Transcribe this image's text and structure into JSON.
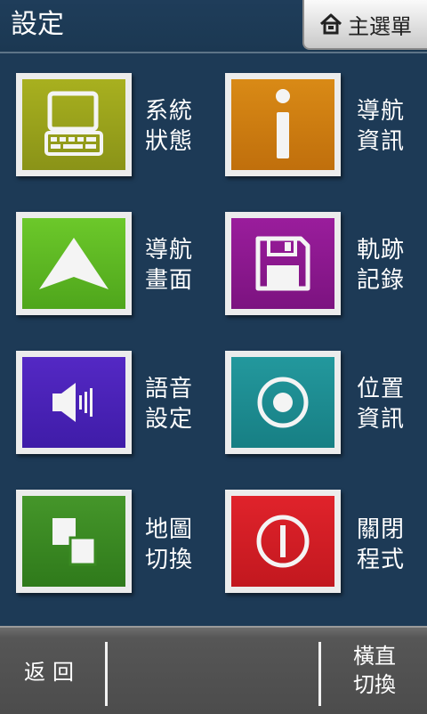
{
  "header": {
    "title": "設定",
    "home_label": "主選單",
    "home_icon": "home-icon"
  },
  "tiles": [
    {
      "label": "系統狀態",
      "icon": "computer-icon",
      "color": "#9aa21d"
    },
    {
      "label": "導航資訊",
      "icon": "info-icon",
      "color": "#d27e10"
    },
    {
      "label": "導航畫面",
      "icon": "arrow-up-icon",
      "color": "#5fbc24"
    },
    {
      "label": "軌跡記錄",
      "icon": "floppy-disk-icon",
      "color": "#8c188f"
    },
    {
      "label": "語音設定",
      "icon": "speaker-icon",
      "color": "#4b22b8"
    },
    {
      "label": "位置資訊",
      "icon": "location-target-icon",
      "color": "#1b8d92"
    },
    {
      "label": "地圖切換",
      "icon": "map-switch-icon",
      "color": "#3a8a22"
    },
    {
      "label": "關閉程式",
      "icon": "power-icon",
      "color": "#d61f26"
    }
  ],
  "bottom": {
    "back_label": "返回",
    "rotate_label": "橫直切換"
  }
}
